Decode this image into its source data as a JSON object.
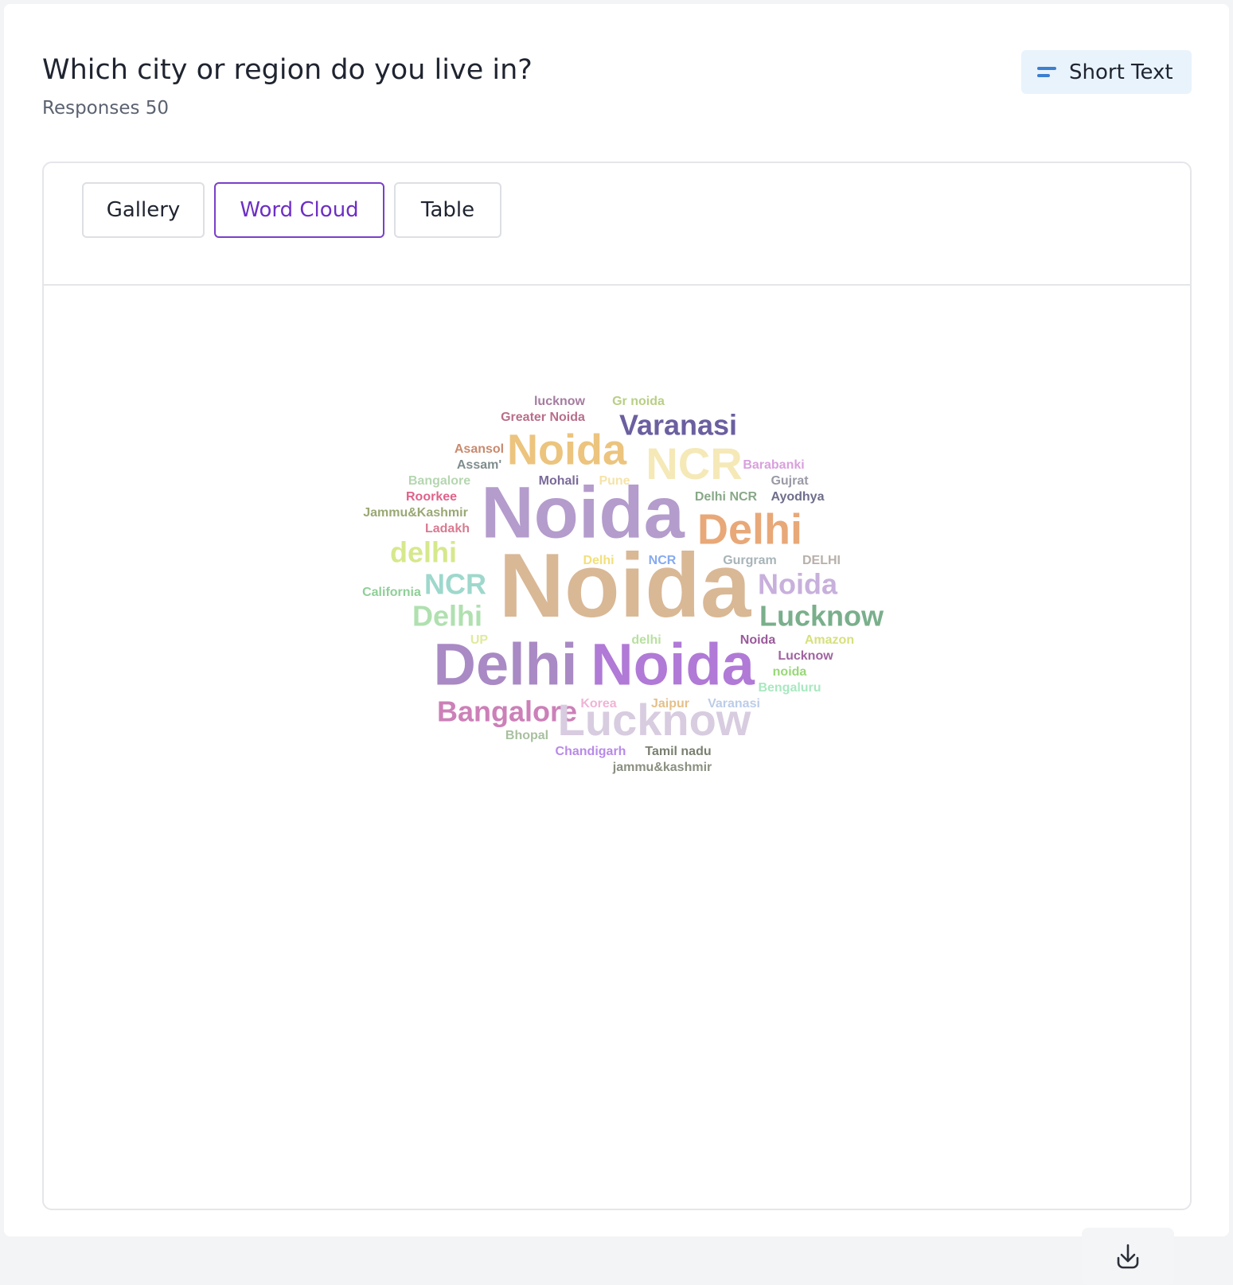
{
  "question": {
    "title": "Which city or region do you live in?",
    "responses_text": "Responses 50"
  },
  "badge": {
    "icon": "short-text-icon",
    "label": "Short Text",
    "icon_color": "#3b7fd1"
  },
  "tabs": [
    {
      "label": "Gallery",
      "active": false
    },
    {
      "label": "Word Cloud",
      "active": true
    },
    {
      "label": "Table",
      "active": false
    }
  ],
  "accent_color": "#6d2fc4",
  "download": {
    "icon": "download-icon"
  },
  "word_cloud": {
    "words": [
      {
        "text": "lucknow",
        "size": 16,
        "color": "#a57ca0"
      },
      {
        "text": "Gr noida",
        "size": 16,
        "color": "#b8cf84"
      },
      {
        "text": "Greater Noida",
        "size": 16,
        "color": "#b86e8a"
      },
      {
        "text": "Varanasi",
        "size": 36,
        "color": "#6b5fa0"
      },
      {
        "text": "Asansol",
        "size": 16,
        "color": "#c98a6e"
      },
      {
        "text": "Noida",
        "size": 54,
        "color": "#ecc47e"
      },
      {
        "text": "NCR",
        "size": 56,
        "color": "#f5e9b8"
      },
      {
        "text": "Assam'",
        "size": 16,
        "color": "#7f8c8d"
      },
      {
        "text": "Barabanki",
        "size": 16,
        "color": "#d9a0dd"
      },
      {
        "text": "Bangalore",
        "size": 16,
        "color": "#b5d6b0"
      },
      {
        "text": "Mohali",
        "size": 16,
        "color": "#7a6a9a"
      },
      {
        "text": "Pune",
        "size": 16,
        "color": "#f5e3a8"
      },
      {
        "text": "Gujrat",
        "size": 16,
        "color": "#9a9aa6"
      },
      {
        "text": "Roorkee",
        "size": 16,
        "color": "#e0628a"
      },
      {
        "text": "Delhi NCR",
        "size": 16,
        "color": "#88a888"
      },
      {
        "text": "Ayodhya",
        "size": 16,
        "color": "#6e6e8c"
      },
      {
        "text": "Jammu&Kashmir",
        "size": 16,
        "color": "#9aa874"
      },
      {
        "text": "Noida",
        "size": 92,
        "color": "#b49ccc"
      },
      {
        "text": "Delhi",
        "size": 54,
        "color": "#e8a878"
      },
      {
        "text": "Ladakh",
        "size": 16,
        "color": "#d87a90"
      },
      {
        "text": "delhi",
        "size": 36,
        "color": "#d6e88c"
      },
      {
        "text": "Delhi",
        "size": 16,
        "color": "#f2e07c"
      },
      {
        "text": "NCR",
        "size": 16,
        "color": "#86aaf0"
      },
      {
        "text": "Gurgram",
        "size": 16,
        "color": "#a8b4b8"
      },
      {
        "text": "DELHI",
        "size": 16,
        "color": "#b8b0aa"
      },
      {
        "text": "California",
        "size": 16,
        "color": "#8fcf98"
      },
      {
        "text": "NCR",
        "size": 36,
        "color": "#9ed8cc"
      },
      {
        "text": "Noida",
        "size": 114,
        "color": "#d9b896"
      },
      {
        "text": "Noida",
        "size": 36,
        "color": "#c8b0dc"
      },
      {
        "text": "Delhi",
        "size": 36,
        "color": "#b0e0b0"
      },
      {
        "text": "Lucknow",
        "size": 36,
        "color": "#7aaf8c"
      },
      {
        "text": "UP",
        "size": 16,
        "color": "#e0ea9c"
      },
      {
        "text": "delhi",
        "size": 16,
        "color": "#b8e0a0"
      },
      {
        "text": "Noida",
        "size": 16,
        "color": "#9a5a9a"
      },
      {
        "text": "Amazon",
        "size": 16,
        "color": "#d6e07e"
      },
      {
        "text": "Delhi",
        "size": 74,
        "color": "#a98ac4"
      },
      {
        "text": "Noida",
        "size": 74,
        "color": "#b07ad6"
      },
      {
        "text": "Lucknow",
        "size": 16,
        "color": "#a064a0"
      },
      {
        "text": "noida",
        "size": 16,
        "color": "#98d878"
      },
      {
        "text": "Bengaluru",
        "size": 16,
        "color": "#a8e8c0"
      },
      {
        "text": "Bangalore",
        "size": 36,
        "color": "#cc80b8"
      },
      {
        "text": "Korea",
        "size": 16,
        "color": "#f0b4d6"
      },
      {
        "text": "Jaipur",
        "size": 16,
        "color": "#e4c08a"
      },
      {
        "text": "Varanasi",
        "size": 16,
        "color": "#bccce8"
      },
      {
        "text": "Lucknow",
        "size": 56,
        "color": "#d8cce0"
      },
      {
        "text": "Bhopal",
        "size": 16,
        "color": "#a8c0a0"
      },
      {
        "text": "Chandigarh",
        "size": 16,
        "color": "#b88ae8"
      },
      {
        "text": "Tamil nadu",
        "size": 16,
        "color": "#7a8070"
      },
      {
        "text": "jammu&kashmir",
        "size": 16,
        "color": "#8a9080"
      }
    ]
  }
}
